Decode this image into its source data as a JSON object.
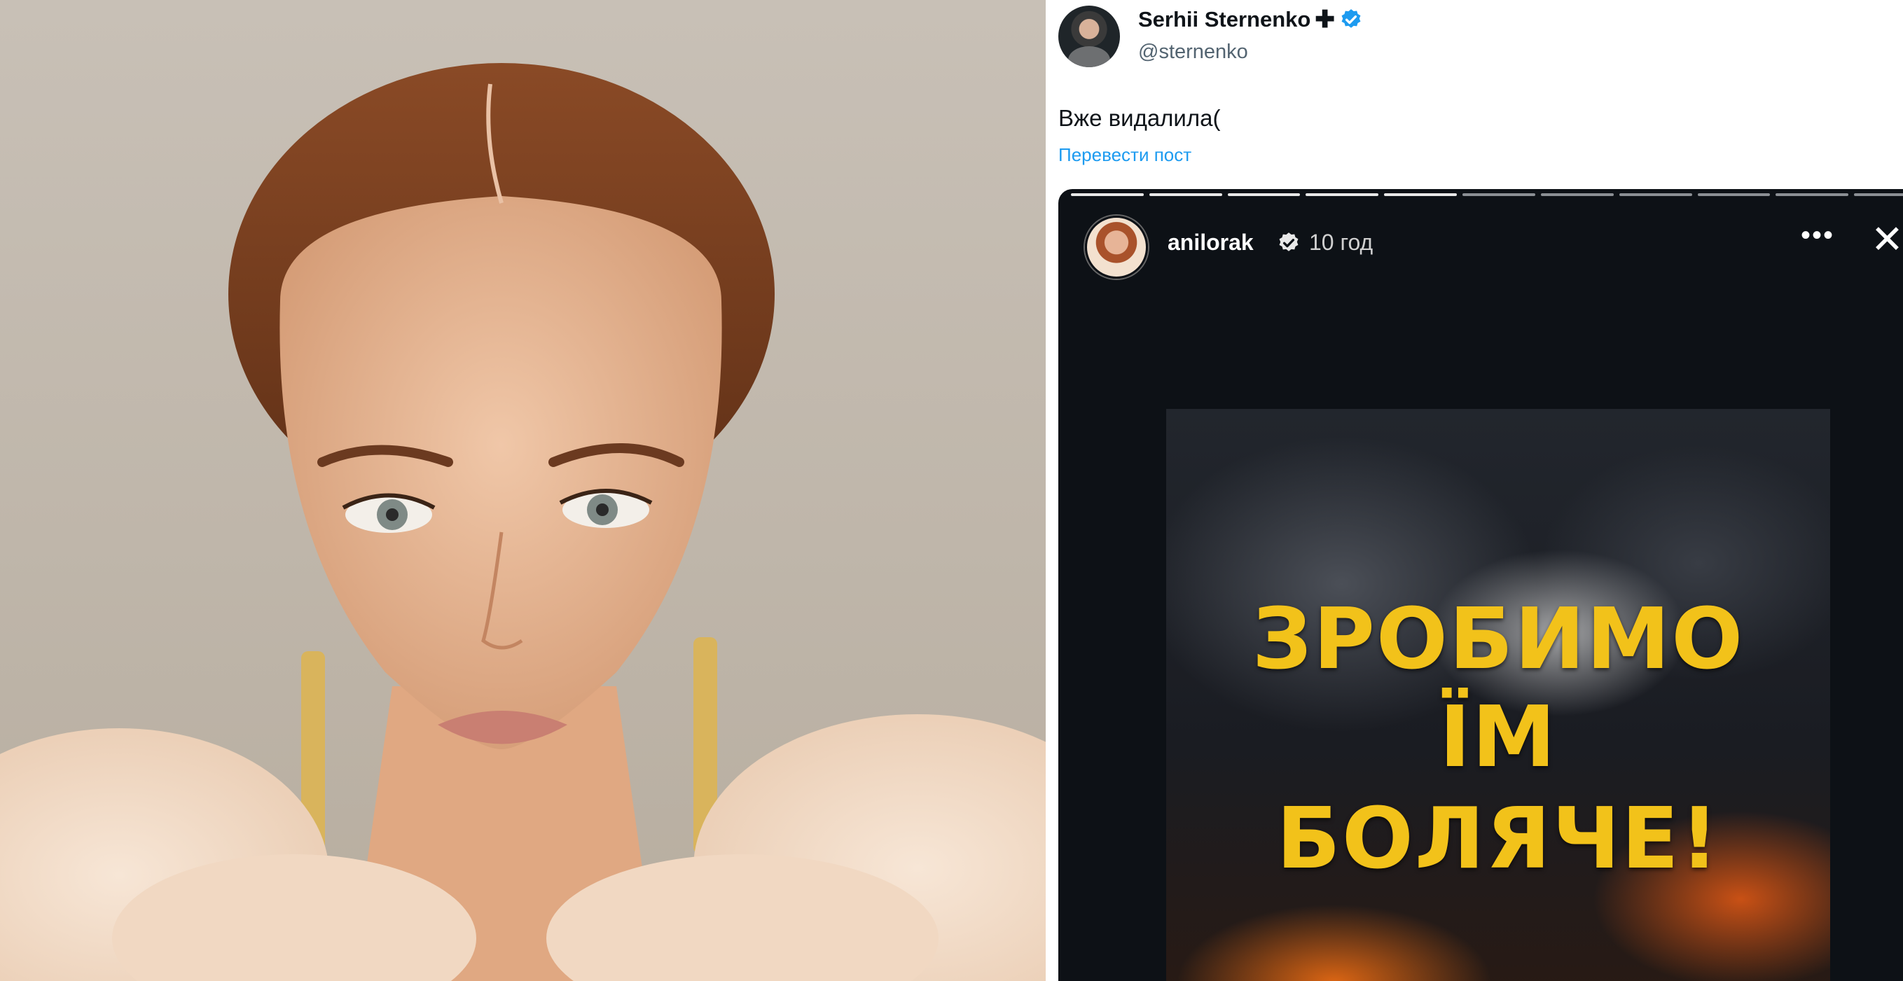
{
  "tweet": {
    "display_name": "Serhii Sternenko",
    "plus_symbol": "✚",
    "handle": "@sternenko",
    "text": "Вже видалила(",
    "translate_label": "Перевести пост"
  },
  "story": {
    "username": "anilorak",
    "time": "10 год",
    "more_label": "•••",
    "close_label": "✕",
    "progress_segments_total": 11,
    "progress_segments_done": 5,
    "headline": [
      "ЗРОБИМО",
      "ЇМ",
      "БОЛЯЧЕ!"
    ]
  },
  "colors": {
    "verified_blue": "#1d9bf0",
    "link_blue": "#1d9bf0",
    "headline_yellow": "#f2c21a",
    "story_bg": "#0d1116"
  }
}
